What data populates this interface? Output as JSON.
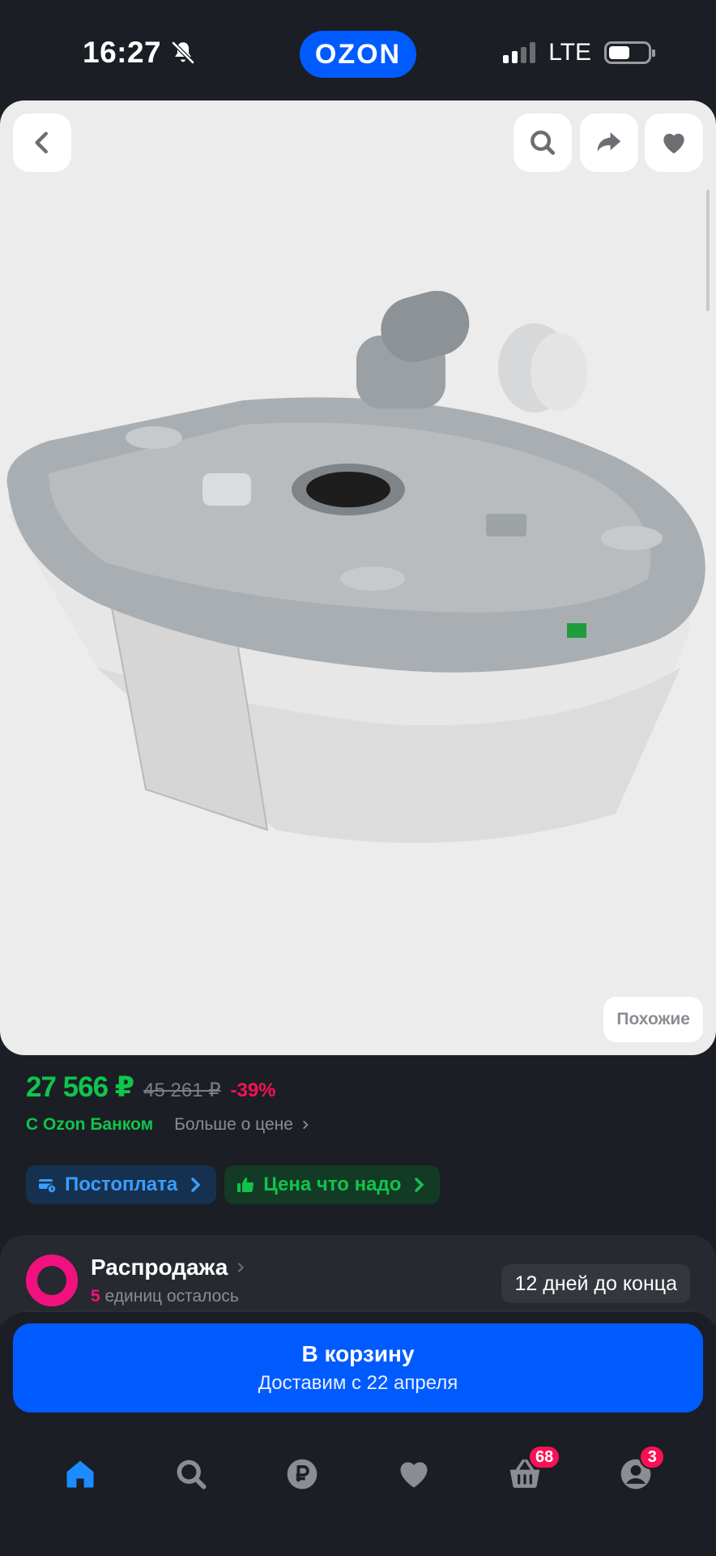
{
  "status_bar": {
    "time": "16:27",
    "app_logo": "OZON",
    "network": "LTE",
    "icons": [
      "bell-muted-icon",
      "signal-icon",
      "battery-icon"
    ]
  },
  "gallery": {
    "similar_label": "Похожие",
    "buttons": [
      "back-icon",
      "search-icon",
      "share-icon",
      "heart-icon"
    ]
  },
  "price": {
    "current": "27 566 ₽",
    "old": "45 261 ₽",
    "discount": "-39%",
    "bank_label": "С Ozon Банком",
    "more_label": "Больше о цене"
  },
  "chips": {
    "postpay": "Постоплата",
    "fair_price": "Цена что надо"
  },
  "sale": {
    "title": "Распродажа",
    "units_count": "5",
    "units_text": "единиц осталось",
    "countdown": "12 дней до конца"
  },
  "cart": {
    "button_label": "В корзину",
    "delivery": "Доставим с 22 апреля"
  },
  "tabbar": {
    "items": [
      "home-icon",
      "search-icon",
      "ruble-icon",
      "heart-icon",
      "basket-icon",
      "profile-icon"
    ],
    "cart_badge": "68",
    "profile_badge": "3"
  },
  "colors": {
    "accent": "#005bff",
    "price_green": "#10c44c",
    "discount_pink": "#f91155",
    "background": "#1b1e24"
  }
}
